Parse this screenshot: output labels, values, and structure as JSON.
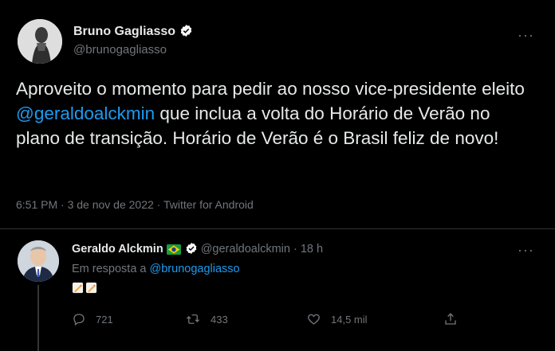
{
  "main_tweet": {
    "author_name": "Bruno Gagliasso",
    "author_handle": "@brunogagliasso",
    "more_label": "···",
    "text_before": "Aproveito o momento para pedir ao nosso vice-presidente eleito ",
    "mention": "@geraldoalckmin",
    "text_after": " que inclua a volta do Horário de Verão no plano de transição. Horário de Verão é o Brasil feliz de novo!",
    "meta": "6:51 PM · 3 de nov de 2022 · Twitter for Android"
  },
  "reply": {
    "author_name": "Geraldo Alckmin",
    "author_handle": "@geraldoalckmin · 18 h",
    "more_label": "···",
    "reply_prefix": "Em resposta a ",
    "reply_mention": "@brunogagliasso",
    "emoji_icon": "memo-icon",
    "actions": {
      "replies": "721",
      "retweets": "433",
      "likes": "14,5 mil"
    }
  },
  "colors": {
    "background": "#000000",
    "text": "#e7e9ea",
    "muted": "#71767b",
    "link": "#1d9bf0",
    "verified": "#ffffff"
  }
}
